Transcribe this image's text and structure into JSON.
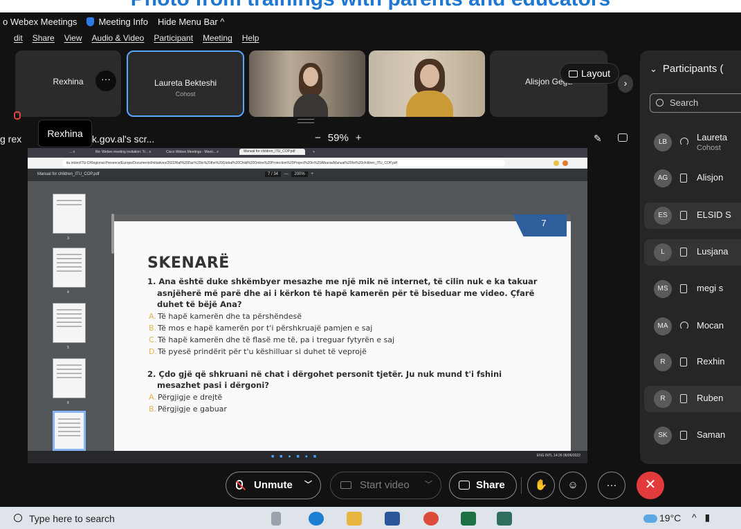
{
  "caption": "Photo from trainings with parents and educators",
  "menubar": {
    "app": "o Webex Meetings",
    "meeting_info": "Meeting Info",
    "hide_menu": "Hide Menu Bar ^"
  },
  "appmenu": [
    "dit",
    "Share",
    "View",
    "Audio & Video",
    "Participant",
    "Meeting",
    "Help"
  ],
  "tiles": [
    {
      "name": "Rexhina",
      "role": ""
    },
    {
      "name": "Laureta Bekteshi",
      "role": "Cohost"
    },
    {
      "name": "",
      "role": ""
    },
    {
      "name": "",
      "role": ""
    },
    {
      "name": "Alisjon Gega",
      "role": ""
    }
  ],
  "layout_label": "Layout",
  "sharebar": {
    "sharing_text": "g rex",
    "sharing_suffix": "cesk.gov.al's scr...",
    "zoom": "59%",
    "minus": "−",
    "plus": "+",
    "tooltip": "Rexhina"
  },
  "shared_screen": {
    "tabs": [
      "... x",
      "Re: Webex meeting invitation: Tr... x",
      "Cisco Webex Meetings - Meeti... x",
      "Manual for children_ITU_COP.pdf",
      "+"
    ],
    "url": "itu.int/en/ITU-D/Regional-Presence/Europe/Documents/Initiatives/2022/Raf%20Dac%20to%20the%20Global%20Child%20Online%20Protection%20Project%20in%20Albania/Manual%20for%20children_ITU_COP.pdf",
    "pdf_filename": "Manual for children_ITU_COP.pdf",
    "page_indicator": "7 / 34",
    "zoom_box": "200%",
    "thumb_numbers": [
      "3",
      "4",
      "5",
      "6",
      "7"
    ],
    "page_number": "7",
    "doc": {
      "heading": "SKENARË",
      "q1_line1": "1. Ana është duke shkëmbyer mesazhe me një mik në internet, të cilin nuk e ka takuar",
      "q1_line2": "asnjëherë më parë dhe ai i kërkon të hapë kamerën për të biseduar me video. Çfarë",
      "q1_line3": "duhet të bëjë Ana?",
      "q1_options": [
        {
          "letter": "A.",
          "text": "Të hapë kamerën dhe ta përshëndesë"
        },
        {
          "letter": "B.",
          "text": "Të mos e hapë kamerën por t'i përshkruajë pamjen e saj"
        },
        {
          "letter": "C.",
          "text": "Të hapë kamerën dhe të flasë me të, pa i treguar fytyrën e saj"
        },
        {
          "letter": "D.",
          "text": "Të pyesë prindërit për t'u këshilluar si duhet të veprojë"
        }
      ],
      "q2_line1": "2. Çdo gjë që shkruani në chat i dërgohet personit tjetër. Ju nuk mund t'i fshini",
      "q2_line2": "mesazhet pasi i dërgoni?",
      "q2_options": [
        {
          "letter": "A.",
          "text": "Përgjigje e drejtë"
        },
        {
          "letter": "B.",
          "text": "Përgjigje e gabuar"
        }
      ]
    },
    "tray_text": "ENG  INTL   14:26  06/06/2022"
  },
  "participants": {
    "title": "Participants (",
    "search_placeholder": "Search",
    "list": [
      {
        "initials": "LB",
        "name": "Laureta",
        "role": "Cohost",
        "device": "phone",
        "highlight": false
      },
      {
        "initials": "AG",
        "name": "Alisjon",
        "role": "",
        "device": "mobile",
        "highlight": false
      },
      {
        "initials": "ES",
        "name": "ELSID S",
        "role": "",
        "device": "mobile",
        "highlight": true
      },
      {
        "initials": "L",
        "name": "Lusjana",
        "role": "",
        "device": "mobile",
        "highlight": true
      },
      {
        "initials": "MS",
        "name": "megi s",
        "role": "",
        "device": "mobile",
        "highlight": false
      },
      {
        "initials": "MA",
        "name": "Mocan",
        "role": "",
        "device": "phone",
        "highlight": false
      },
      {
        "initials": "R",
        "name": "Rexhin",
        "role": "",
        "device": "mobile",
        "highlight": false
      },
      {
        "initials": "R",
        "name": "Ruben",
        "role": "",
        "device": "mobile",
        "highlight": true
      },
      {
        "initials": "SK",
        "name": "Saman",
        "role": "",
        "device": "mobile",
        "highlight": false
      }
    ]
  },
  "controls": {
    "unmute": "Unmute",
    "start_video": "Start video",
    "share": "Share",
    "more": "···",
    "hangup": "✕"
  },
  "taskbar": {
    "search_placeholder": "Type here to search",
    "weather": "19°C"
  },
  "colors": {
    "accent": "#58a6ff",
    "hangup": "#e33b3b",
    "caption": "#1f77d0",
    "doc_band": "#2f5e9c",
    "option_letter": "#e3b54b"
  }
}
